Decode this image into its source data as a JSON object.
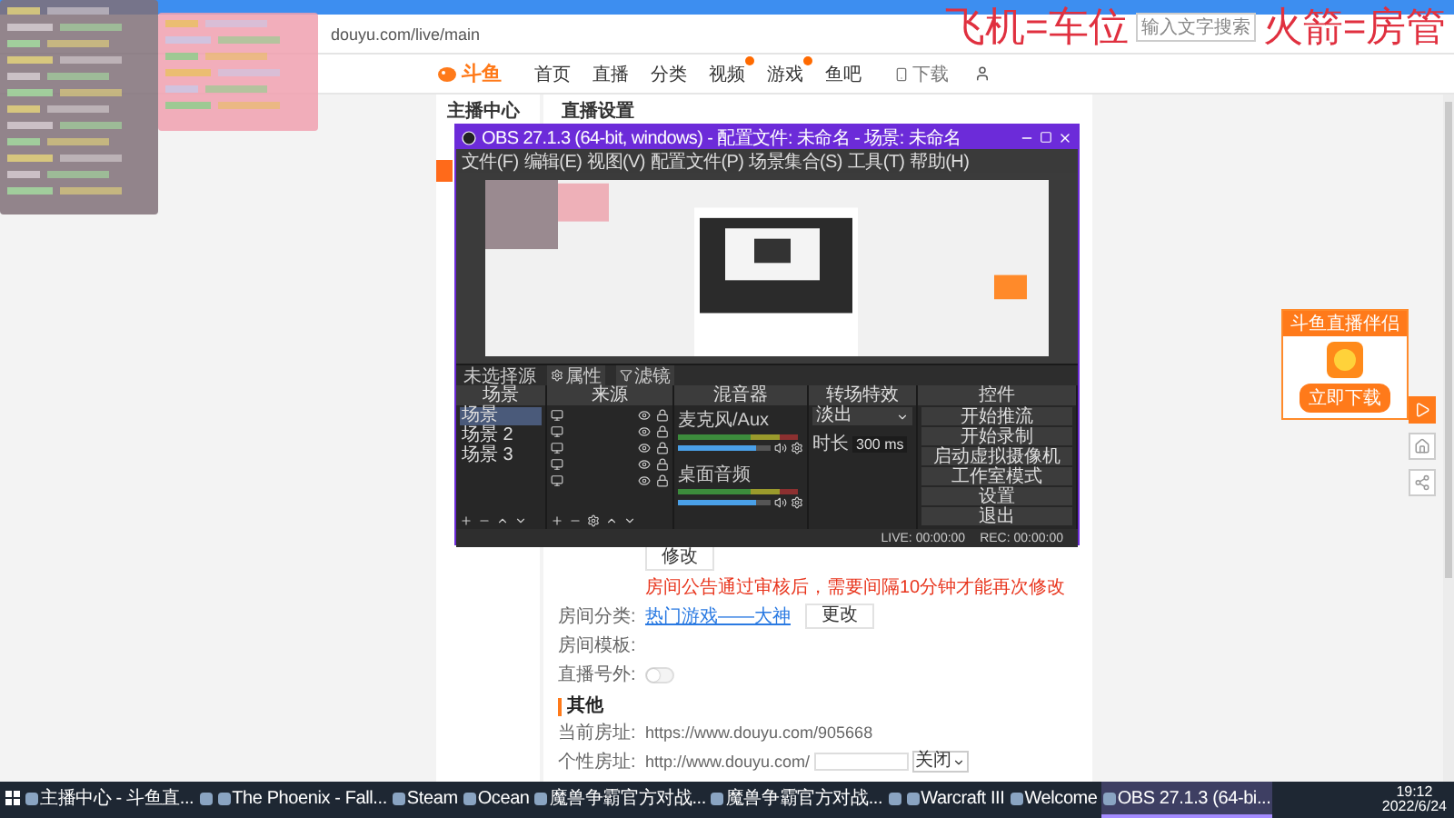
{
  "browser": {
    "address": "douyu.com/live/main"
  },
  "stream_caption": {
    "left": "飞机=车位",
    "search_placeholder": "输入文字搜索",
    "right": "火箭=房管"
  },
  "site_header": {
    "logo": "斗鱼",
    "nav": [
      {
        "label": "首页",
        "badge": false
      },
      {
        "label": "直播",
        "badge": false
      },
      {
        "label": "分类",
        "badge": false
      },
      {
        "label": "视频",
        "badge": true
      },
      {
        "label": "游戏",
        "badge": true
      },
      {
        "label": "鱼吧",
        "badge": false
      }
    ],
    "download": "下载"
  },
  "sidebar": {
    "title": "主播中心"
  },
  "main": {
    "title": "直播设置",
    "edit_button": "修改",
    "notice": "房间公告通过审核后，需要间隔10分钟才能再次修改",
    "fields": [
      {
        "kind": "link",
        "label": "房间分类:",
        "value": "热门游戏——大神",
        "button": "更改"
      },
      {
        "kind": "empty",
        "label": "房间模板:"
      },
      {
        "kind": "toggle",
        "label": "直播号外:",
        "on": false
      }
    ],
    "other": {
      "title": "其他",
      "fields": [
        {
          "kind": "text",
          "label": "当前房址:",
          "value": "https://www.douyu.com/905668"
        },
        {
          "kind": "input",
          "label": "个性房址:",
          "prefix": "http://www.douyu.com/",
          "select": "关闭"
        }
      ]
    }
  },
  "obs": {
    "title": "OBS 27.1.3 (64-bit, windows) - 配置文件: 未命名 - 场景: 未命名",
    "menu": [
      "文件(F)",
      "编辑(E)",
      "视图(V)",
      "配置文件(P)",
      "场景集合(S)",
      "工具(T)",
      "帮助(H)"
    ],
    "source_bar": {
      "label": "未选择源",
      "buttons": [
        "属性",
        "滤镜"
      ]
    },
    "docks": [
      {
        "title": "场景",
        "kind": "scenes"
      },
      {
        "title": "来源",
        "kind": "sources"
      },
      {
        "title": "混音器",
        "kind": "mixer"
      },
      {
        "title": "转场特效",
        "kind": "transitions"
      },
      {
        "title": "控件",
        "kind": "controls"
      }
    ],
    "scenes": [
      {
        "name": "场景",
        "selected": true
      },
      {
        "name": "场景 2",
        "selected": false
      },
      {
        "name": "场景 3",
        "selected": false
      }
    ],
    "mixer": [
      {
        "name": "麦克风/Aux",
        "level": 0.85
      },
      {
        "name": "桌面音频",
        "level": 0.85
      }
    ],
    "transition": {
      "type": "淡出",
      "duration_label": "时长",
      "duration": "300 ms"
    },
    "controls": [
      "开始推流",
      "开始录制",
      "启动虚拟摄像机",
      "工作室模式",
      "设置",
      "退出"
    ],
    "status": [
      "LIVE: 00:00:00",
      "REC: 00:00:00"
    ]
  },
  "promo": {
    "title": "斗鱼直播伴侣",
    "button": "立即下载"
  },
  "taskbar": {
    "items": [
      {
        "label": "主播中心 - 斗鱼直...",
        "selected": false
      },
      {
        "selected": false
      },
      {
        "label": "The Phoenix - Fall...",
        "selected": false
      },
      {
        "label": "Steam",
        "selected": false
      },
      {
        "label": "Ocean",
        "selected": false
      },
      {
        "label": "魔兽争霸官方对战...",
        "selected": false
      },
      {
        "label": "魔兽争霸官方对战...",
        "selected": false
      },
      {
        "selected": false
      },
      {
        "label": "Warcraft III",
        "selected": false
      },
      {
        "label": "Welcome",
        "selected": false
      },
      {
        "label": "OBS 27.1.3 (64-bi...",
        "selected": true
      }
    ],
    "time": "19:12",
    "date": "2022/6/24"
  }
}
